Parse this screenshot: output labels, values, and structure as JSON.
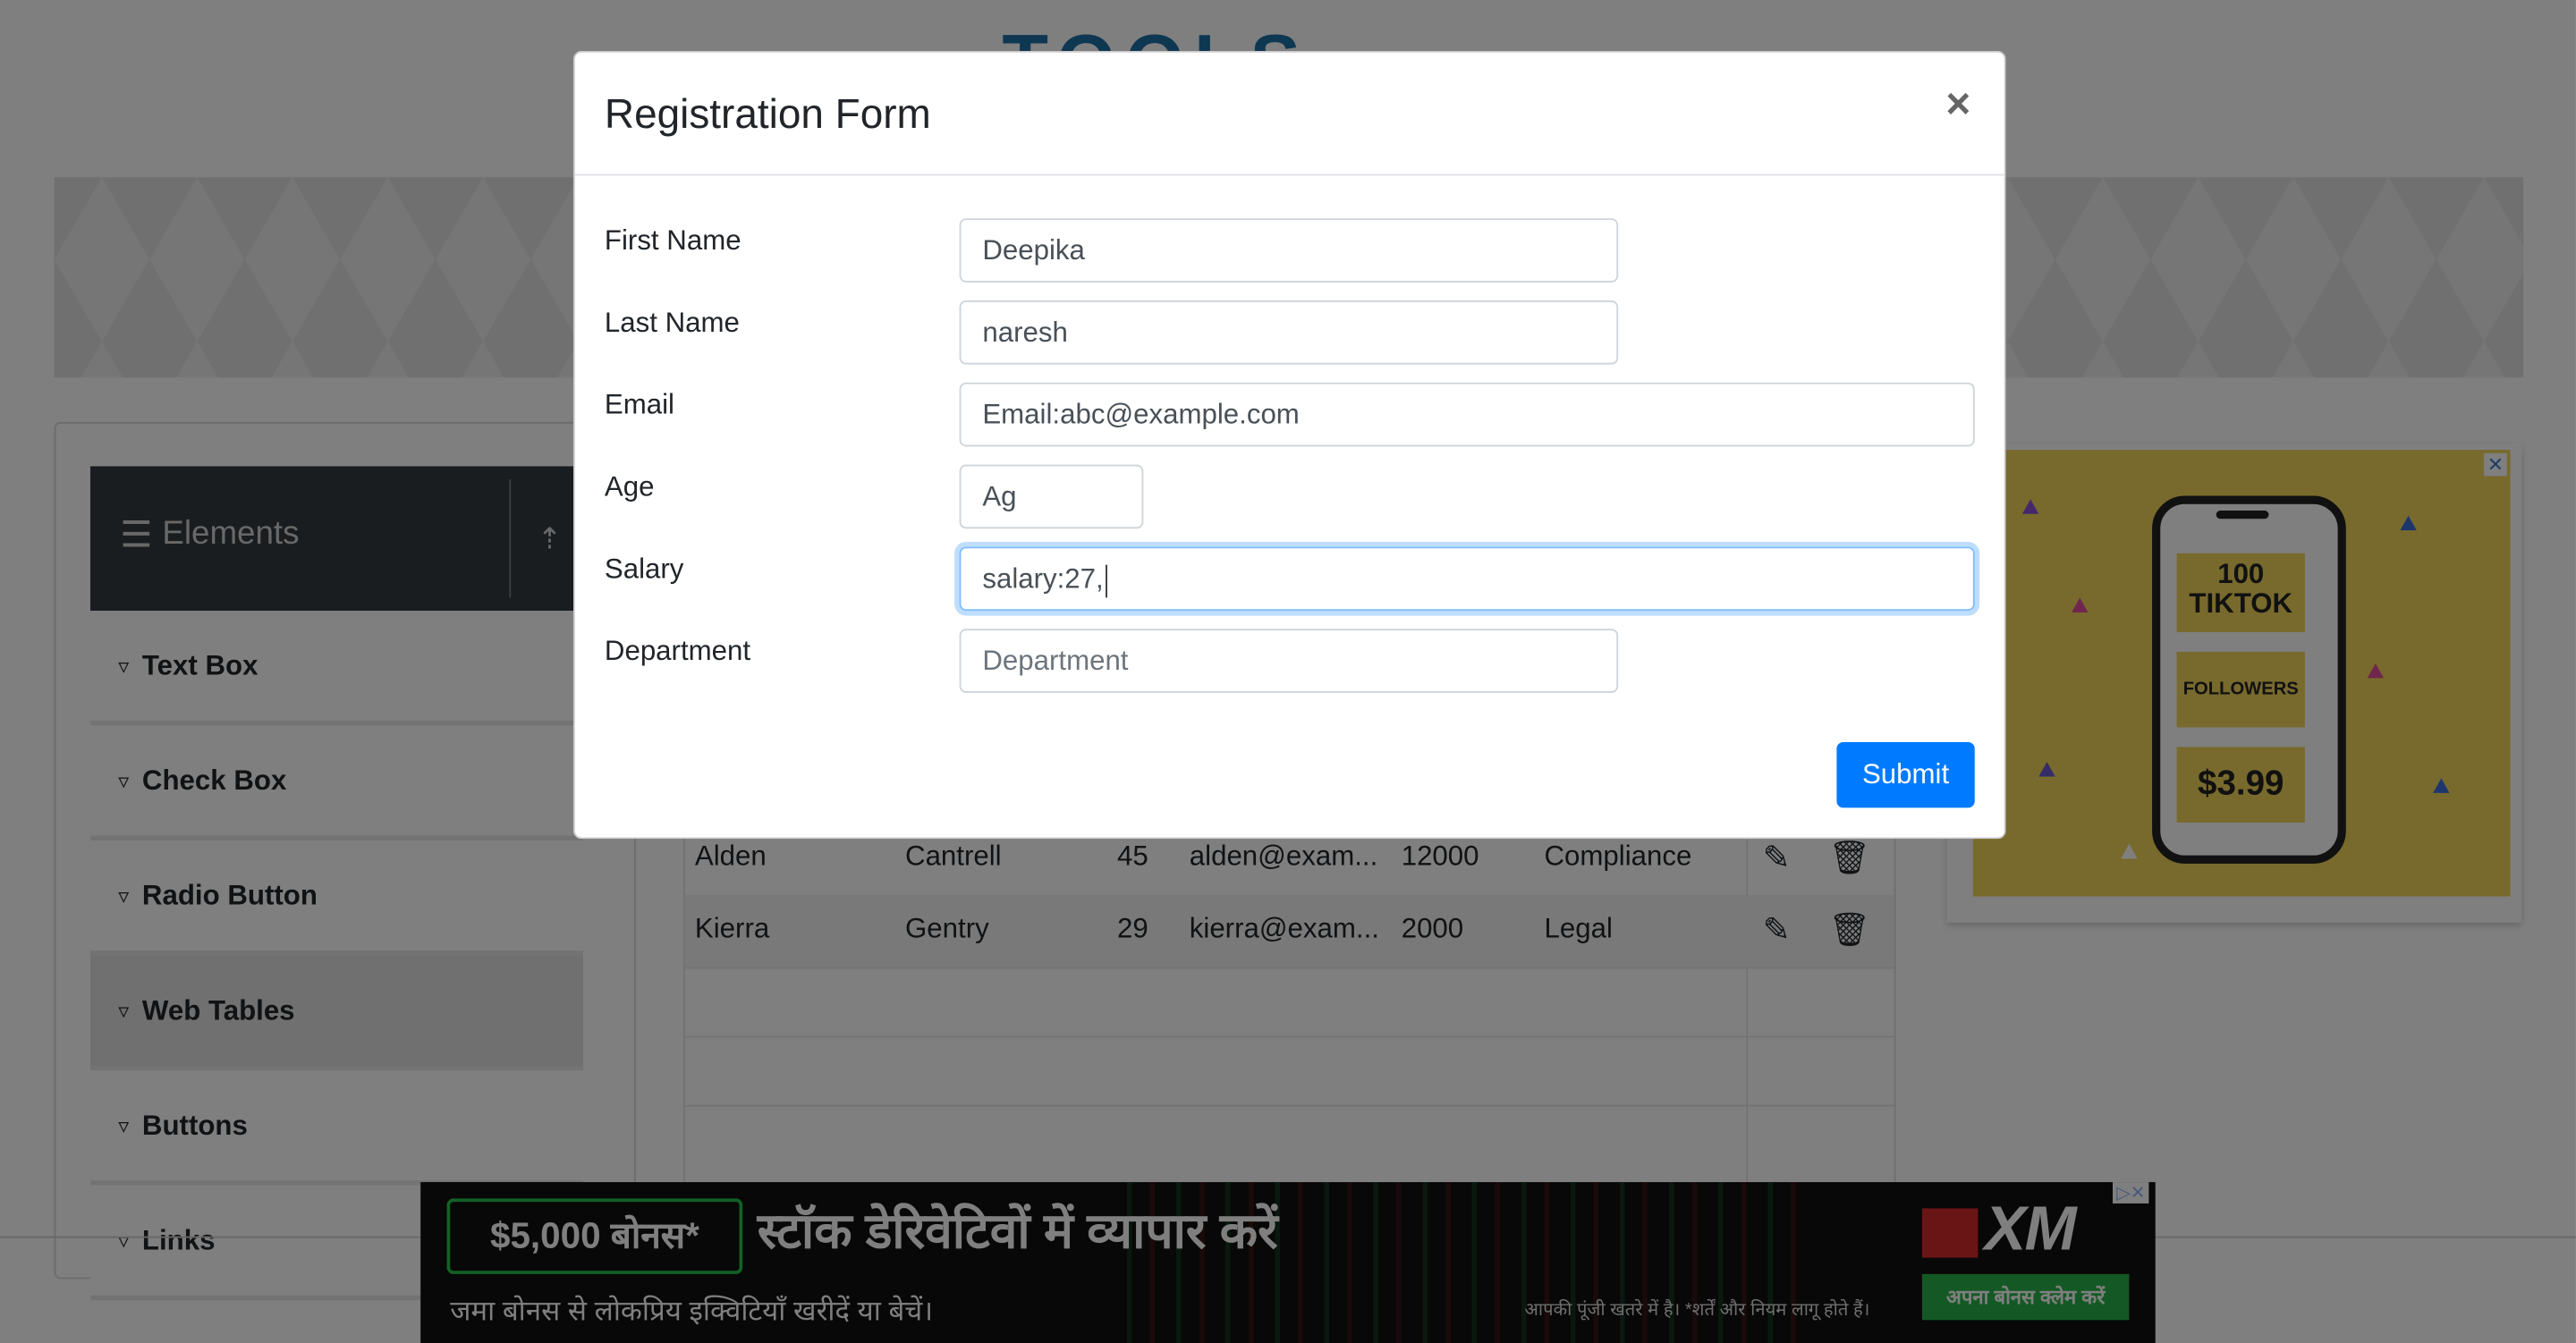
{
  "background": {
    "logo_text": "TOOLS",
    "sidebar": {
      "header_label": "Elements",
      "items": [
        {
          "label": "Text Box"
        },
        {
          "label": "Check Box"
        },
        {
          "label": "Radio Button"
        },
        {
          "label": "Web Tables",
          "active": true
        },
        {
          "label": "Buttons"
        },
        {
          "label": "Links"
        }
      ]
    },
    "table": {
      "rows": [
        {
          "first": "Alden",
          "last": "Cantrell",
          "age": "45",
          "email": "alden@exam...",
          "salary": "12000",
          "department": "Compliance"
        },
        {
          "first": "Kierra",
          "last": "Gentry",
          "age": "29",
          "email": "kierra@exam...",
          "salary": "2000",
          "department": "Legal"
        }
      ]
    },
    "side_ad": {
      "line1": "100",
      "line2": "TIKTOK",
      "line3": "FOLLOWERS",
      "price": "$3.99"
    },
    "bottom_ad": {
      "bonus": "$5,000 बोनस*",
      "headline": "स्टॉक डेरिवेटिवों में व्यापार करें",
      "subline": "जमा बोनस से लोकप्रिय इक्विटियाँ खरीदें या बेचें।",
      "disclaimer": "आपकी पूंजी खतरे में है। *शर्तें और नियम लागू होते हैं।",
      "brand": "XM",
      "cta": "अपना बोनस क्लेम करें"
    }
  },
  "modal": {
    "title": "Registration Form",
    "close_label": "×",
    "fields": {
      "first_name": {
        "label": "First Name",
        "value": "Deepika"
      },
      "last_name": {
        "label": "Last Name",
        "value": "naresh"
      },
      "email": {
        "label": "Email",
        "value": "Email:abc@example.com"
      },
      "age": {
        "label": "Age",
        "value": "Ag"
      },
      "salary": {
        "label": "Salary",
        "value": "salary:27,"
      },
      "department": {
        "label": "Department",
        "placeholder": "Department"
      }
    },
    "submit_label": "Submit"
  },
  "colors": {
    "primary": "#007bff",
    "overlay": "rgba(0,0,0,0.5)",
    "sidebar_header": "#343a40",
    "ad_yellow": "#f1d55a",
    "ad_green": "#27c24c"
  }
}
